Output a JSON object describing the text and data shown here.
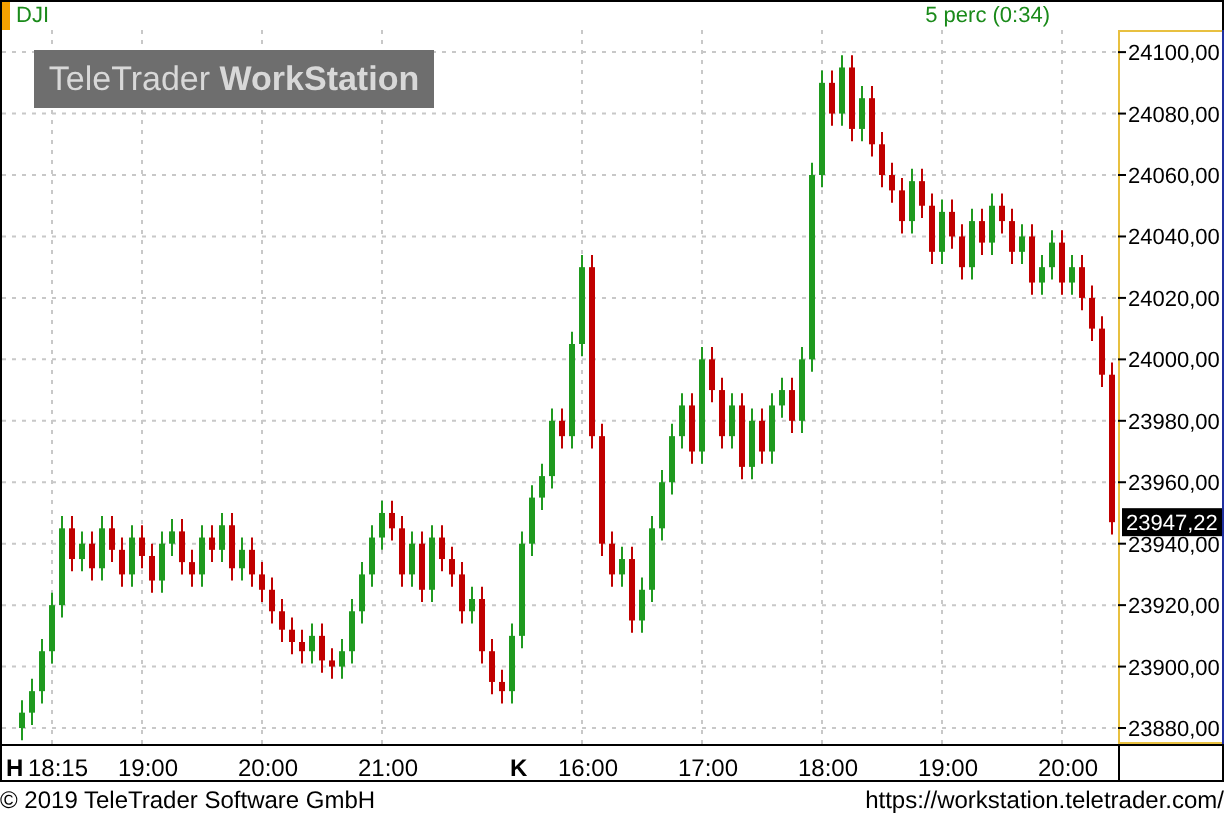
{
  "header": {
    "interval": "5 perc (0:34)"
  },
  "logo": {
    "brand": "TeleTrader",
    "product": "WorkStation"
  },
  "chart": {
    "chart_data": {
      "type": "candlestick",
      "title": "DJI",
      "grid": true,
      "ylim": [
        23874.8,
        24107.2
      ],
      "yticks": [
        {
          "value": 23880,
          "label": "23880,00"
        },
        {
          "value": 23900,
          "label": "23900,00"
        },
        {
          "value": 23920,
          "label": "23920,00"
        },
        {
          "value": 23940,
          "label": "23940,00"
        },
        {
          "value": 23960,
          "label": "23960,00"
        },
        {
          "value": 23980,
          "label": "23980,00"
        },
        {
          "value": 24000,
          "label": "24000,00"
        },
        {
          "value": 24020,
          "label": "24020,00"
        },
        {
          "value": 24040,
          "label": "24040,00"
        },
        {
          "value": 24060,
          "label": "24060,00"
        },
        {
          "value": 24080,
          "label": "24080,00"
        },
        {
          "value": 24100,
          "label": "24100,00"
        }
      ],
      "ohlc": [
        [
          23880,
          23889,
          23876,
          23885
        ],
        [
          23885,
          23896,
          23881,
          23892
        ],
        [
          23892,
          23909,
          23888,
          23905
        ],
        [
          23905,
          23924,
          23901,
          23920
        ],
        [
          23920,
          23949,
          23916,
          23945
        ],
        [
          23945,
          23949,
          23931,
          23935
        ],
        [
          23935,
          23944,
          23931,
          23940
        ],
        [
          23940,
          23944,
          23928,
          23932
        ],
        [
          23932,
          23949,
          23928,
          23945
        ],
        [
          23945,
          23949,
          23934,
          23938
        ],
        [
          23938,
          23942,
          23926,
          23930
        ],
        [
          23930,
          23946,
          23926,
          23942
        ],
        [
          23942,
          23946,
          23932,
          23936
        ],
        [
          23936,
          23940,
          23924,
          23928
        ],
        [
          23928,
          23944,
          23924,
          23940
        ],
        [
          23940,
          23948,
          23936,
          23944
        ],
        [
          23944,
          23948,
          23930,
          23934
        ],
        [
          23934,
          23938,
          23926,
          23930
        ],
        [
          23930,
          23946,
          23926,
          23942
        ],
        [
          23942,
          23946,
          23934,
          23938
        ],
        [
          23938,
          23950,
          23934,
          23946
        ],
        [
          23946,
          23950,
          23928,
          23932
        ],
        [
          23932,
          23942,
          23928,
          23938
        ],
        [
          23938,
          23942,
          23926,
          23930
        ],
        [
          23930,
          23934,
          23921,
          23925
        ],
        [
          23925,
          23929,
          23914,
          23918
        ],
        [
          23918,
          23922,
          23908,
          23912
        ],
        [
          23912,
          23916,
          23904,
          23908
        ],
        [
          23908,
          23912,
          23901,
          23905
        ],
        [
          23905,
          23914,
          23901,
          23910
        ],
        [
          23910,
          23914,
          23898,
          23902
        ],
        [
          23902,
          23906,
          23896,
          23900
        ],
        [
          23900,
          23909,
          23896,
          23905
        ],
        [
          23905,
          23922,
          23901,
          23918
        ],
        [
          23918,
          23934,
          23914,
          23930
        ],
        [
          23930,
          23946,
          23926,
          23942
        ],
        [
          23942,
          23954,
          23938,
          23950
        ],
        [
          23950,
          23954,
          23941,
          23945
        ],
        [
          23945,
          23949,
          23926,
          23930
        ],
        [
          23930,
          23944,
          23926,
          23940
        ],
        [
          23940,
          23944,
          23921,
          23925
        ],
        [
          23925,
          23946,
          23921,
          23942
        ],
        [
          23942,
          23946,
          23931,
          23935
        ],
        [
          23935,
          23939,
          23926,
          23930
        ],
        [
          23930,
          23934,
          23914,
          23918
        ],
        [
          23918,
          23926,
          23914,
          23922
        ],
        [
          23922,
          23926,
          23901,
          23905
        ],
        [
          23905,
          23909,
          23891,
          23895
        ],
        [
          23895,
          23899,
          23888,
          23892
        ],
        [
          23892,
          23914,
          23888,
          23910
        ],
        [
          23910,
          23944,
          23906,
          23940
        ],
        [
          23940,
          23959,
          23936,
          23955
        ],
        [
          23955,
          23966,
          23951,
          23962
        ],
        [
          23962,
          23984,
          23958,
          23980
        ],
        [
          23980,
          23984,
          23971,
          23975
        ],
        [
          23975,
          24009,
          23971,
          24005
        ],
        [
          24005,
          24034,
          24001,
          24030
        ],
        [
          24030,
          24034,
          23971,
          23975
        ],
        [
          23975,
          23979,
          23936,
          23940
        ],
        [
          23940,
          23944,
          23926,
          23930
        ],
        [
          23930,
          23939,
          23926,
          23935
        ],
        [
          23935,
          23939,
          23911,
          23915
        ],
        [
          23915,
          23929,
          23911,
          23925
        ],
        [
          23925,
          23949,
          23921,
          23945
        ],
        [
          23945,
          23964,
          23941,
          23960
        ],
        [
          23960,
          23979,
          23956,
          23975
        ],
        [
          23975,
          23989,
          23971,
          23985
        ],
        [
          23985,
          23989,
          23966,
          23970
        ],
        [
          23970,
          24004,
          23966,
          24000
        ],
        [
          24000,
          24004,
          23986,
          23990
        ],
        [
          23990,
          23994,
          23971,
          23975
        ],
        [
          23975,
          23989,
          23971,
          23985
        ],
        [
          23985,
          23989,
          23961,
          23965
        ],
        [
          23965,
          23984,
          23961,
          23980
        ],
        [
          23980,
          23984,
          23966,
          23970
        ],
        [
          23970,
          23989,
          23966,
          23985
        ],
        [
          23985,
          23994,
          23981,
          23990
        ],
        [
          23990,
          23994,
          23976,
          23980
        ],
        [
          23980,
          24004,
          23976,
          24000
        ],
        [
          24000,
          24064,
          23996,
          24060
        ],
        [
          24060,
          24094,
          24056,
          24090
        ],
        [
          24090,
          24094,
          24076,
          24080
        ],
        [
          24080,
          24099,
          24076,
          24095
        ],
        [
          24095,
          24099,
          24071,
          24075
        ],
        [
          24075,
          24089,
          24071,
          24085
        ],
        [
          24085,
          24089,
          24066,
          24070
        ],
        [
          24070,
          24074,
          24056,
          24060
        ],
        [
          24060,
          24064,
          24051,
          24055
        ],
        [
          24055,
          24059,
          24041,
          24045
        ],
        [
          24045,
          24062,
          24041,
          24058
        ],
        [
          24058,
          24062,
          24046,
          24050
        ],
        [
          24050,
          24054,
          24031,
          24035
        ],
        [
          24035,
          24052,
          24031,
          24048
        ],
        [
          24048,
          24052,
          24036,
          24040
        ],
        [
          24040,
          24044,
          24026,
          24030
        ],
        [
          24030,
          24049,
          24026,
          24045
        ],
        [
          24045,
          24049,
          24034,
          24038
        ],
        [
          24038,
          24054,
          24034,
          24050
        ],
        [
          24050,
          24054,
          24041,
          24045
        ],
        [
          24045,
          24049,
          24031,
          24035
        ],
        [
          24035,
          24044,
          24031,
          24040
        ],
        [
          24040,
          24044,
          24021,
          24025
        ],
        [
          24025,
          24034,
          24021,
          24030
        ],
        [
          24030,
          24042,
          24026,
          24038
        ],
        [
          24038,
          24042,
          24021,
          24025
        ],
        [
          24025,
          24034,
          24021,
          24030
        ],
        [
          24030,
          24034,
          24016,
          24020
        ],
        [
          24020,
          24024,
          24006,
          24010
        ],
        [
          24010,
          24014,
          23991,
          23995
        ],
        [
          23995,
          23999,
          23943,
          23947
        ]
      ]
    }
  },
  "last_price": {
    "label": "23947,22"
  },
  "day_markers": [
    {
      "label": "H"
    },
    {
      "label": "K"
    }
  ],
  "time_axis": [
    {
      "label": "18:15"
    },
    {
      "label": "19:00"
    },
    {
      "label": "20:00"
    },
    {
      "label": "21:00"
    },
    {
      "label": "16:00"
    },
    {
      "label": "17:00"
    },
    {
      "label": "18:00"
    },
    {
      "label": "19:00"
    },
    {
      "label": "20:00"
    }
  ],
  "footer": {
    "copyright": "© 2019 TeleTrader Software GmbH",
    "url": "https://workstation.teletrader.com/"
  }
}
